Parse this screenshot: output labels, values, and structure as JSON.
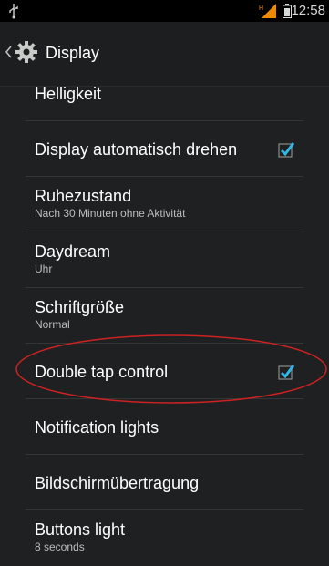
{
  "status_bar": {
    "time": "12:58",
    "usb_icon": "usb-icon",
    "signal_icon": "signal-icon",
    "battery_icon": "battery-icon"
  },
  "action_bar": {
    "title": "Display",
    "icon": "gear-icon"
  },
  "settings": [
    {
      "title": "Helligkeit",
      "subtitle": "",
      "checkbox": false
    },
    {
      "title": "Display automatisch drehen",
      "subtitle": "",
      "checkbox": true,
      "checked": true
    },
    {
      "title": "Ruhezustand",
      "subtitle": "Nach 30 Minuten ohne Aktivität",
      "checkbox": false
    },
    {
      "title": "Daydream",
      "subtitle": "Uhr",
      "checkbox": false
    },
    {
      "title": "Schriftgröße",
      "subtitle": "Normal",
      "checkbox": false
    },
    {
      "title": "Double tap control",
      "subtitle": "",
      "checkbox": true,
      "checked": true
    },
    {
      "title": "Notification lights",
      "subtitle": "",
      "checkbox": false
    },
    {
      "title": "Bildschirmübertragung",
      "subtitle": "",
      "checkbox": false
    },
    {
      "title": "Buttons light",
      "subtitle": "8 seconds",
      "checkbox": false
    }
  ],
  "colors": {
    "background": "#1f2021",
    "accent": "#33b5e5",
    "annotation": "#cc2222"
  }
}
